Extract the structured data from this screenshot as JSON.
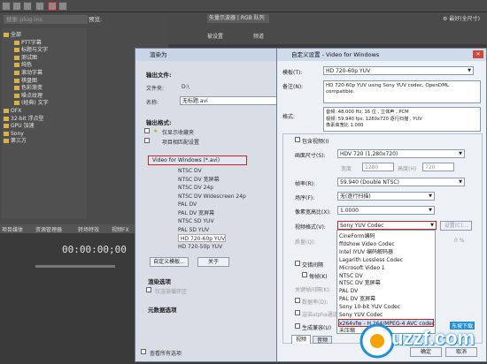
{
  "toolbar": {
    "search_placeholder": "搜索 plug-ins",
    "preview_label": "预览:"
  },
  "monitor": {
    "select_label": "矢量示波器 | RGB 队列",
    "channel_label": "频道",
    "scope_label": "被设置"
  },
  "tree": [
    {
      "label": "全部"
    },
    {
      "label": "PTT字幕"
    },
    {
      "label": "标题与文字"
    },
    {
      "label": "测试图"
    },
    {
      "label": "纯色"
    },
    {
      "label": "滚动字幕"
    },
    {
      "label": "棋盘图"
    },
    {
      "label": "色彩渐变"
    },
    {
      "label": "噪点纹理"
    },
    {
      "label": "(经典) 文字"
    },
    {
      "label": "OFX"
    },
    {
      "label": "32-bit 浮点型"
    },
    {
      "label": "GPU 加速"
    },
    {
      "label": "Sony"
    },
    {
      "label": "第三方"
    }
  ],
  "bottom_tabs": [
    "项目媒体",
    "资源管理器",
    "转场特效",
    "视频FX"
  ],
  "timecode": "00:00:00;00",
  "render": {
    "title": "渲染为",
    "output_file_label": "输出文件:",
    "folder_label": "文件夹:",
    "folder_value": "D:\\",
    "name_label": "名称:",
    "name_value": "无标题.avi",
    "output_format_label": "输出格式:",
    "favorites_label": "仅显示收藏夹",
    "match_label": "项目相匹配设置",
    "format_header": "Video for Windows (*.avi)",
    "formats": [
      "NTSC DV",
      "NTSC DV 宽屏幕",
      "NTSC DV 24p",
      "NTSC DV Widescreen 24p",
      "PAL DV",
      "PAL DV 宽屏幕",
      "NTSC SD YUV",
      "PAL SD YUV",
      "HD 720-60p YUV",
      "HD 720-50p YUV"
    ],
    "custom_button": "自定义模板...",
    "about_button": "关于",
    "render_options_label": "渲染选项",
    "render_loop_label": "仅渲染循环区",
    "metadata_label": "元数据选项",
    "show_all_label": "查看所有选项"
  },
  "custom": {
    "title": "自定义设置 - Video for Windows",
    "template_label": "模板(T):",
    "template_value": "HD 720-60p YUV",
    "notes_label": "备注(N):",
    "notes_value": "HD 720-60p YUV using Sony YUV codec, OpenDML compatible.",
    "format_label": "格式:",
    "format_value": [
      "音频:   48.000 Hz, 16 位 , 立体声 , PCM",
      "视频:   59.940 fps, 1280x720 逐行扫描  , YUV",
      "像素高宽比 1.000"
    ],
    "include_video_label": "包含视频(I)",
    "frame_size_label": "画面尺寸(S):",
    "frame_size_value": "HDV 720 (1,280x720)",
    "width_label": "宽度",
    "width_value": "1280",
    "height_label": "高度(H)",
    "height_value": "720",
    "frame_rate_label": "帧率(R):",
    "frame_rate_value": "59.940 (Double NTSC)",
    "field_order_label": "场序(F):",
    "field_order_value": "无(逐行扫描)",
    "pixel_aspect_label": "像素宽高比(X):",
    "pixel_aspect_value": "1.0000",
    "video_format_label": "视频格式(V):",
    "video_format_value": "Sony YUV Codec",
    "configure_button": "设置(C)...",
    "quality_label": "质量(Q):",
    "quality_value": "0 %",
    "interleave_label": "交错间隔",
    "keyframe_label": "每帧(K)",
    "keyframe_interval_label": "关键帧间隔(K):",
    "datarate_label": "数据率(D):",
    "alpha_label": "渲染alpha通道",
    "build_compat_label": "生成兼容(U)",
    "tab_video": "视频",
    "tab_audio": "音频",
    "ok_button": "确定",
    "cancel_button": "取消",
    "codec_list": [
      "CineForm编码",
      "ffdshow Video Codec",
      "Intel IYUV 编码解码器",
      "Lagarith Lossless Codec",
      "Microsoft Video 1",
      "NTSC DV",
      "NTSC DV 宽屏幕",
      "PAL DV",
      "PAL DV 宽屏幕",
      "Sony 10-bit YUV Codec",
      "Sony YUV Codec",
      "x264vfw - H.264/MPEG-4 AVC codec",
      "未压缩"
    ]
  },
  "watermark": {
    "text": "uzzf.com",
    "sub": "东坡下载"
  },
  "colors": {
    "highlight_red": "#d42020",
    "watermark_blue": "#1f8fd6"
  }
}
